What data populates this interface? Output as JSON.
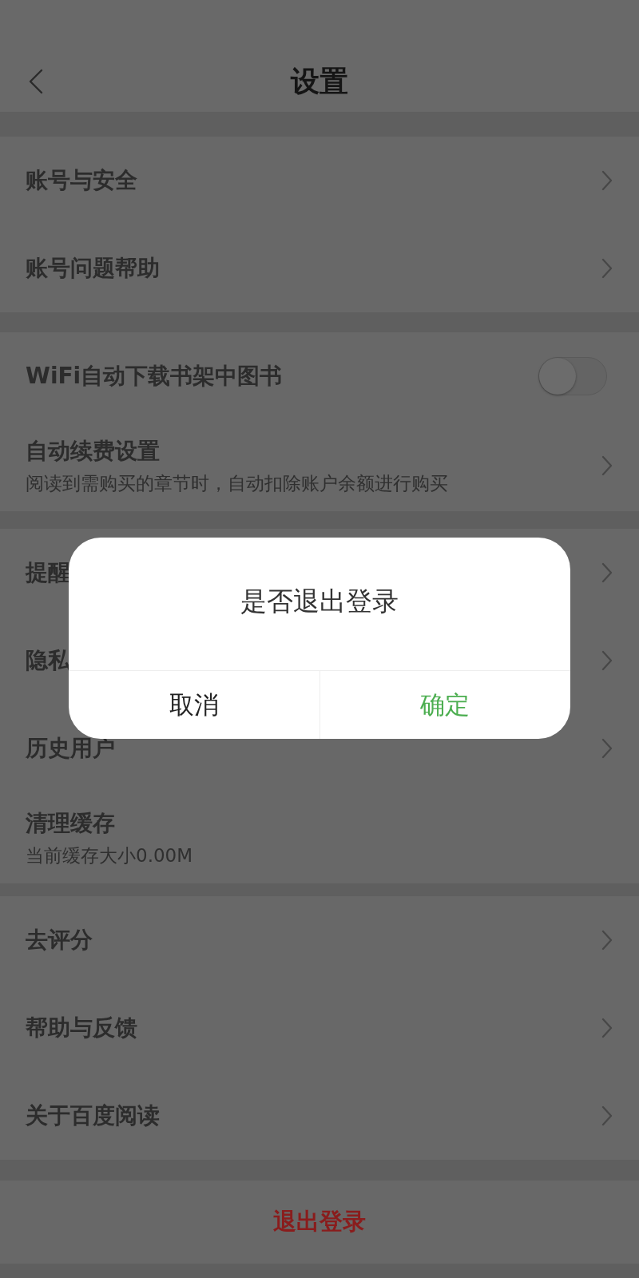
{
  "header": {
    "title": "设置"
  },
  "sections": [
    {
      "rows": [
        {
          "kind": "link",
          "title": "账号与安全"
        },
        {
          "kind": "link",
          "title": "账号问题帮助"
        }
      ]
    },
    {
      "rows": [
        {
          "kind": "toggle",
          "title": "WiFi自动下载书架中图书",
          "on": false
        },
        {
          "kind": "link",
          "title": "自动续费设置",
          "subtitle": "阅读到需购买的章节时，自动扣除账户余额进行购买"
        }
      ]
    },
    {
      "rows": [
        {
          "kind": "link",
          "title": "提醒"
        },
        {
          "kind": "link",
          "title": "隐私"
        },
        {
          "kind": "link",
          "title": "历史用户"
        },
        {
          "kind": "info",
          "title": "清理缓存",
          "subtitle": "当前缓存大小0.00M"
        }
      ]
    },
    {
      "rows": [
        {
          "kind": "link",
          "title": "去评分"
        },
        {
          "kind": "link",
          "title": "帮助与反馈"
        },
        {
          "kind": "link",
          "title": "关于百度阅读"
        }
      ]
    }
  ],
  "logout_button": {
    "label": "退出登录"
  },
  "dialog": {
    "message": "是否退出登录",
    "buttons": [
      {
        "kind": "cancel",
        "label": "取消"
      },
      {
        "kind": "confirm",
        "label": "确定"
      }
    ]
  }
}
